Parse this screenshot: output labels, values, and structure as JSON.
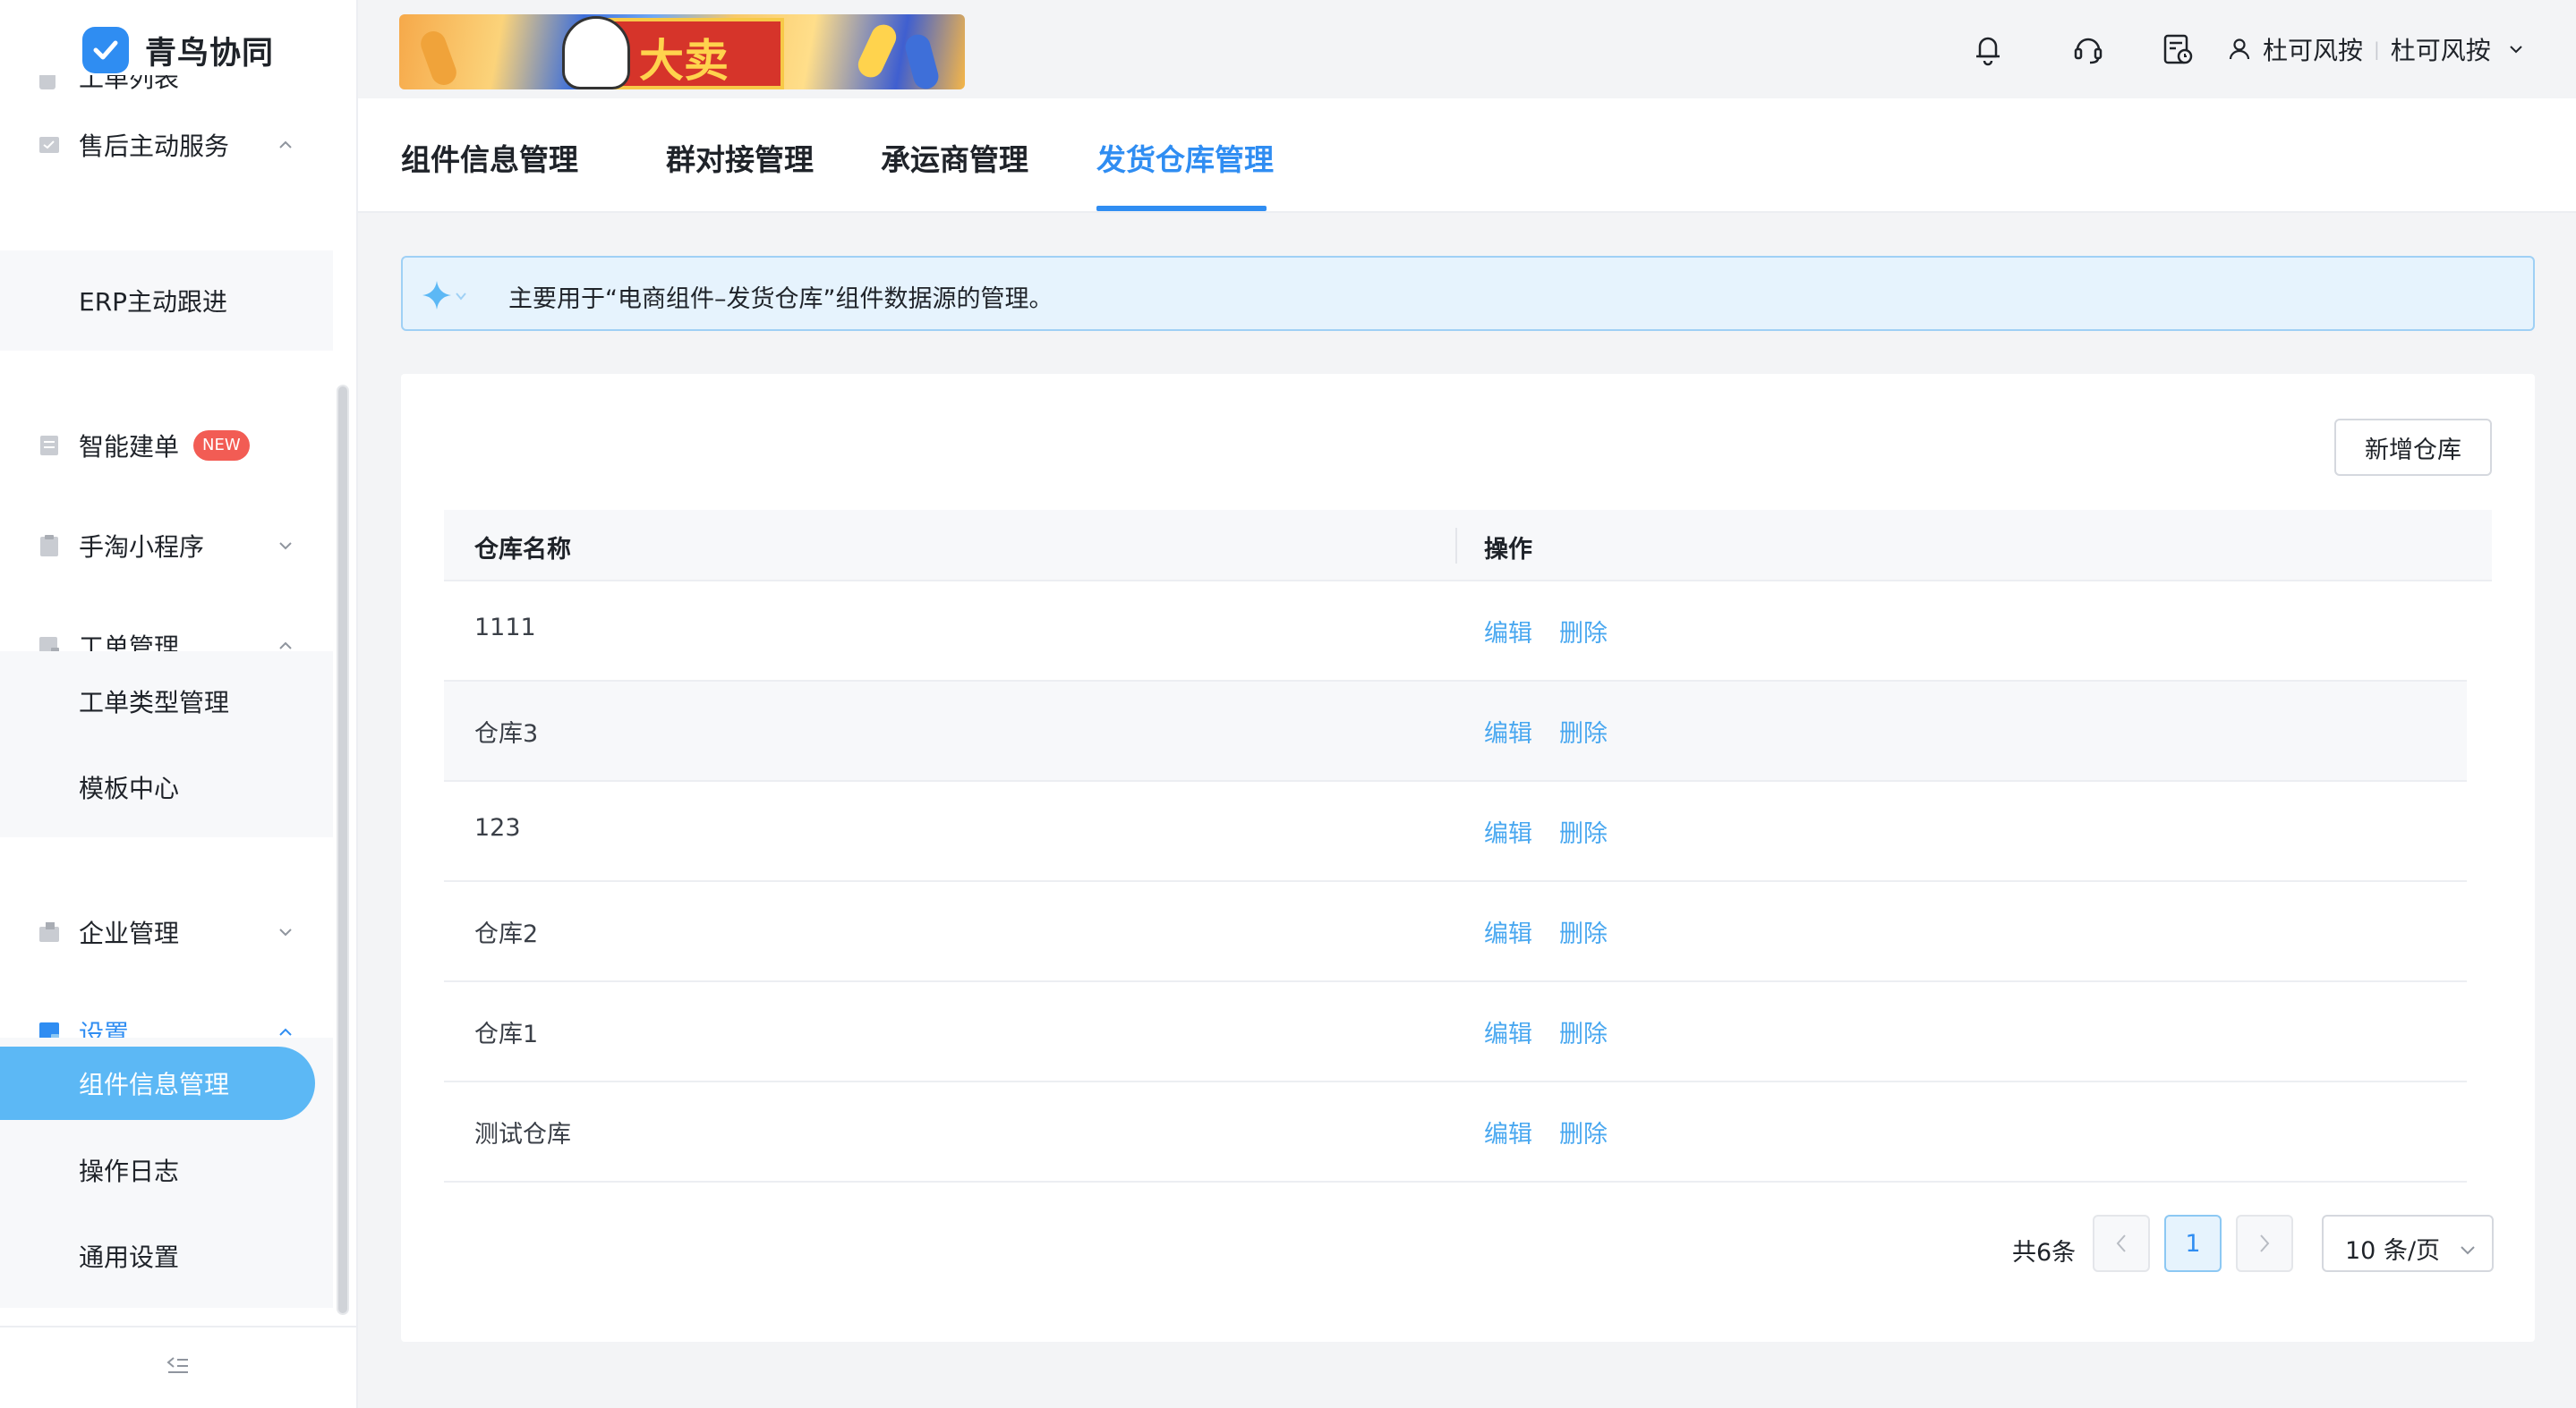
{
  "app": {
    "name": "青鸟协同",
    "brand_color": "#2f8df2"
  },
  "banner": {
    "text": "大卖"
  },
  "header": {
    "icons": [
      "bell-icon",
      "headset-icon",
      "calendar-settings-icon"
    ],
    "user": {
      "org": "杜可风按",
      "name": "杜可风按"
    }
  },
  "sidebar": {
    "cut_item": {
      "label": "工单列表"
    },
    "items": [
      {
        "label": "售后主动服务",
        "icon": "check-square-icon",
        "caret": "up"
      },
      {
        "label": "智能建单",
        "icon": "doc-icon",
        "badge": "NEW"
      },
      {
        "label": "手淘小程序",
        "icon": "clipboard-icon",
        "caret": "down"
      },
      {
        "label": "工单管理",
        "icon": "ticket-icon",
        "caret": "up"
      },
      {
        "label": "企业管理",
        "icon": "building-icon",
        "caret": "down"
      },
      {
        "label": "设置",
        "icon": "settings-doc-icon",
        "caret": "up"
      }
    ],
    "sub_after_service": [
      {
        "label": "ERP主动跟进"
      }
    ],
    "sub_ticket": [
      {
        "label": "工单类型管理"
      },
      {
        "label": "模板中心"
      }
    ],
    "sub_settings": [
      {
        "label": "组件信息管理"
      },
      {
        "label": "操作日志"
      },
      {
        "label": "通用设置"
      }
    ]
  },
  "tabs": [
    {
      "label": "组件信息管理"
    },
    {
      "label": "群对接管理"
    },
    {
      "label": "承运商管理"
    },
    {
      "label": "发货仓库管理"
    }
  ],
  "active_tab": "发货仓库管理",
  "notice": {
    "text": "主要用于“电商组件–发货仓库”组件数据源的管理。"
  },
  "toolbar": {
    "add_label": "新增仓库"
  },
  "table": {
    "columns": [
      "仓库名称",
      "操作"
    ],
    "rows": [
      {
        "name": "1111",
        "edit": "编辑",
        "delete": "删除"
      },
      {
        "name": "仓库3",
        "edit": "编辑",
        "delete": "删除"
      },
      {
        "name": "123",
        "edit": "编辑",
        "delete": "删除"
      },
      {
        "name": "仓库2",
        "edit": "编辑",
        "delete": "删除"
      },
      {
        "name": "仓库1",
        "edit": "编辑",
        "delete": "删除"
      },
      {
        "name": "测试仓库",
        "edit": "编辑",
        "delete": "删除"
      }
    ]
  },
  "pagination": {
    "total": "共6条",
    "current": "1",
    "page_size": "10 条/页"
  }
}
